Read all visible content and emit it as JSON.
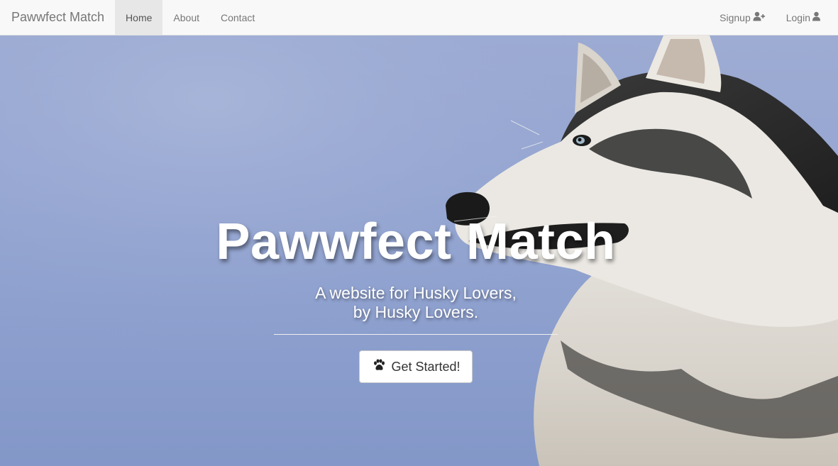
{
  "navbar": {
    "brand": "Pawwfect Match",
    "links": [
      {
        "label": "Home",
        "active": true
      },
      {
        "label": "About",
        "active": false
      },
      {
        "label": "Contact",
        "active": false
      }
    ],
    "signup": {
      "label": "Signup",
      "icon": "user-plus-icon"
    },
    "login": {
      "label": "Login",
      "icon": "user-icon"
    }
  },
  "hero": {
    "title": "Pawwfect Match",
    "subtitle_line1": "A website for Husky Lovers,",
    "subtitle_line2": "by Husky Lovers.",
    "cta_label": "Get Started!",
    "cta_icon": "paw-icon",
    "image": "husky-dog-profile"
  },
  "colors": {
    "navbar_bg": "#f8f8f8",
    "active_tab_bg": "#e7e7e7",
    "sky_blue": "#94a5d1",
    "text_light": "#ffffff"
  }
}
